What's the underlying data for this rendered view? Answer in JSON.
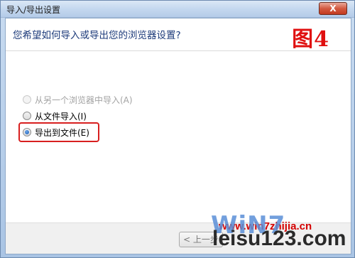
{
  "window": {
    "title": "导入/导出设置",
    "close_glyph": "X"
  },
  "header": {
    "question": "您希望如何导入或导出您的浏览器设置?",
    "figure_label": "图4"
  },
  "options": [
    {
      "label": "从另一个浏览器中导入(A)",
      "selected": false,
      "enabled": false
    },
    {
      "label": "从文件导入(I)",
      "selected": false,
      "enabled": true
    },
    {
      "label": "导出到文件(E)",
      "selected": true,
      "enabled": true
    }
  ],
  "footer": {
    "back_label": "< 上一步"
  },
  "watermarks": {
    "url": "www.win7zhijia.cn",
    "logo": "WiN7",
    "site": "leisu123.com"
  },
  "colors": {
    "highlight": "#d81f1f",
    "figure_label": "#e01010",
    "question_text": "#1c3a7a"
  }
}
